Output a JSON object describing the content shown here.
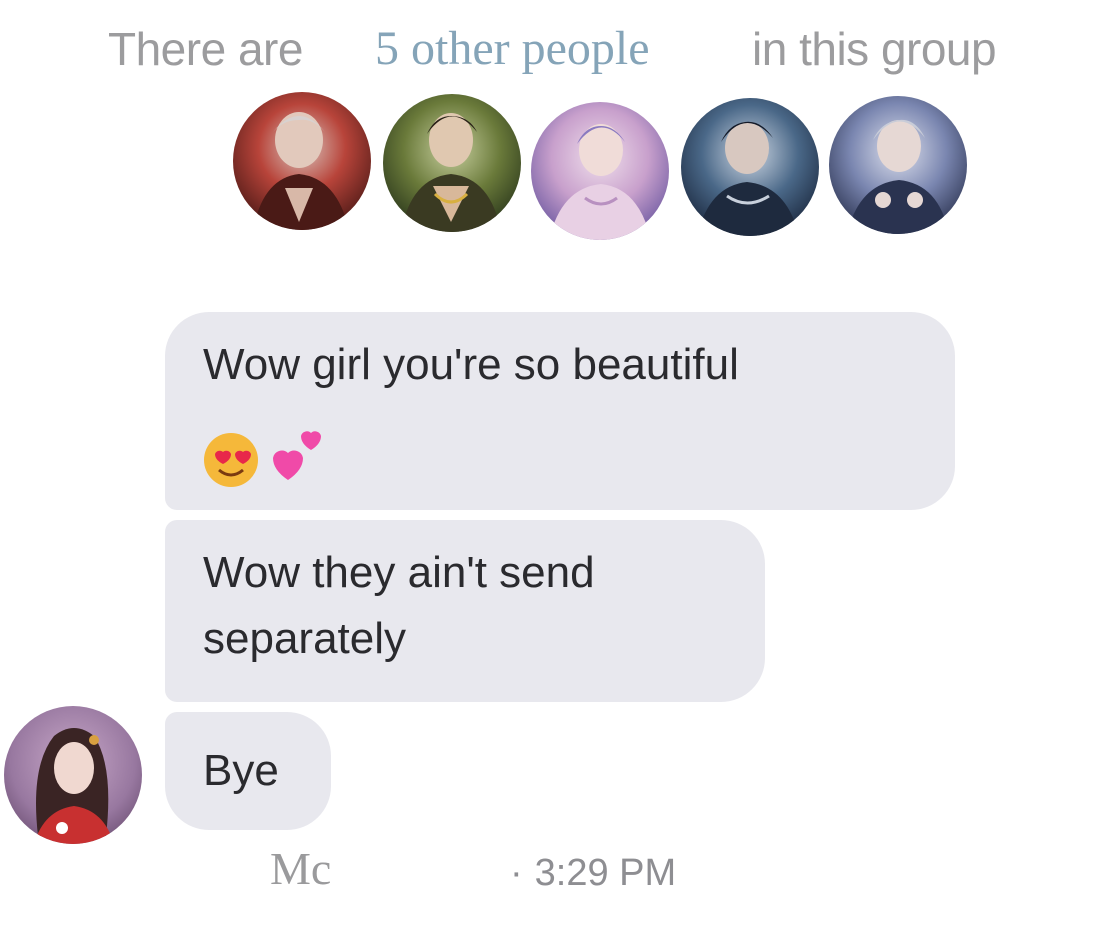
{
  "header": {
    "prefix": "There are",
    "link": "5 other people",
    "suffix": "in this group"
  },
  "members": [
    {
      "icon": "member-avatar-1",
      "palette": [
        "#5a1e1c",
        "#b8443a",
        "#d9c7c0"
      ]
    },
    {
      "icon": "member-avatar-2",
      "palette": [
        "#3a4a2a",
        "#8a7a3a",
        "#d8c6a8"
      ]
    },
    {
      "icon": "member-avatar-3",
      "palette": [
        "#6a5aa8",
        "#d8a8d0",
        "#f0e0ec"
      ]
    },
    {
      "icon": "member-avatar-4",
      "palette": [
        "#1e2c44",
        "#5a7898",
        "#cfd8e4"
      ]
    },
    {
      "icon": "member-avatar-5",
      "palette": [
        "#2a3350",
        "#7a86b0",
        "#dfe2ee"
      ]
    }
  ],
  "messages": [
    {
      "line1": "Wow girl you're so beautiful",
      "emojis": [
        "smiling-heart-eyes-emoji",
        "two-hearts-emoji"
      ]
    },
    {
      "line1": "Wow they ain't send",
      "line2": "separately"
    },
    {
      "line1": "Bye"
    }
  ],
  "sender": {
    "name": "Mc",
    "avatar_icon": "sender-avatar",
    "separator": "·",
    "time": "3:29 PM"
  },
  "colors": {
    "bubble": "#e8e8ee",
    "link": "#85a4b8",
    "muted_text": "#9c9c9e",
    "message_text": "#2a2a2e"
  }
}
